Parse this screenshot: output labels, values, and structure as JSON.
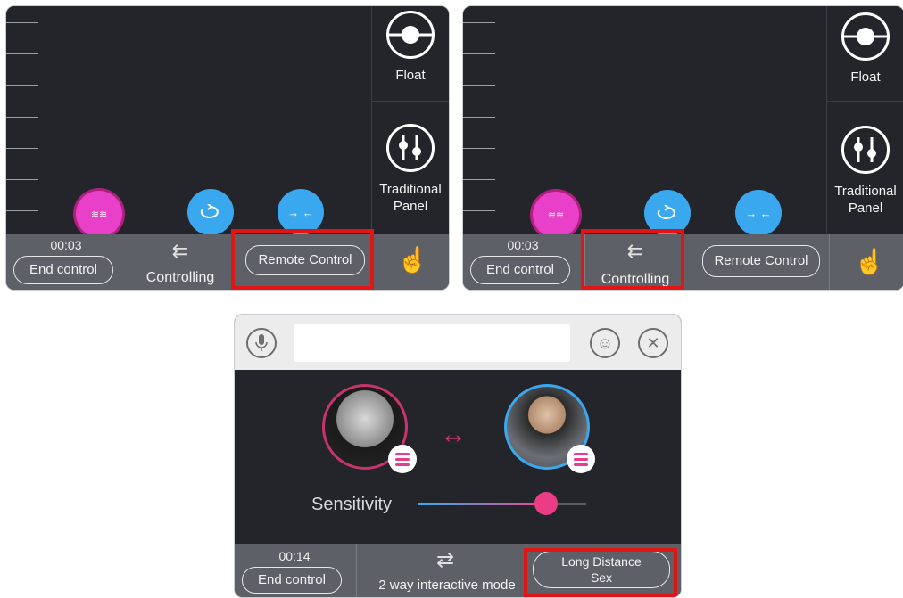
{
  "top_left_panel": {
    "side": {
      "float_label": "Float",
      "traditional_label_1": "Traditional",
      "traditional_label_2": "Panel"
    },
    "bar": {
      "timer": "00:03",
      "end_label": "End control",
      "controlling_label": "Controlling",
      "remote_label": "Remote Control"
    },
    "highlighted": "remote-control-button"
  },
  "top_right_panel": {
    "side": {
      "float_label": "Float",
      "traditional_label_1": "Traditional",
      "traditional_label_2": "Panel"
    },
    "bar": {
      "timer": "00:03",
      "end_label": "End control",
      "controlling_label": "Controlling",
      "remote_label": "Remote Control"
    },
    "highlighted": "controlling-button"
  },
  "bottom_panel": {
    "sensitivity_label": "Sensitivity",
    "sensitivity_fraction": 0.76,
    "bar": {
      "timer": "00:14",
      "end_label": "End control",
      "mode_label": "2 way interactive mode",
      "ld_label_1": "Long Distance",
      "ld_label_2": "Sex"
    },
    "highlighted": "long-distance-sex-button"
  },
  "icons": {
    "mic": "microphone-icon",
    "smiley": "smiley-icon",
    "close": "close-icon",
    "float": "float-icon",
    "panel": "traditional-panel-icon",
    "hand": "touch-hand-icon",
    "wave": "wave-mode-icon",
    "loop": "loop-mode-icon",
    "arrows": "arrows-mode-icon",
    "swap": "swap-icon",
    "bidir": "bidirectional-arrow-icon"
  },
  "colors": {
    "highlight": "#e01515",
    "accent_pink": "#ea3d86",
    "accent_blue": "#3aa8ef",
    "dark_bg": "#23252b",
    "bar_bg": "#5d6067"
  }
}
